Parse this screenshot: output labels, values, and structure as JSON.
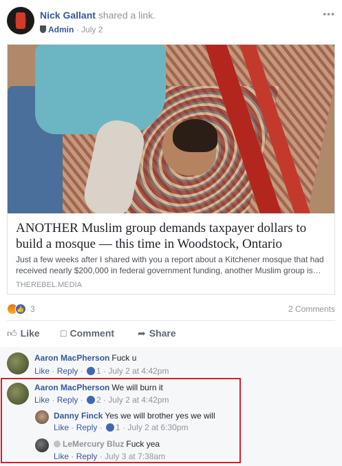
{
  "post": {
    "author": "Nick Gallant",
    "action": "shared a link.",
    "role": "Admin",
    "date": "July 2",
    "more": "•••"
  },
  "link": {
    "title": "ANOTHER Muslim group demands taxpayer dollars to build a mosque — this time in Woodstock, Ontario",
    "description": "Just a few weeks after I shared with you a report about a Kitchener mosque that had received nearly $200,000 in federal government funding, another Muslim group is…",
    "domain": "THEREBEL.MEDIA"
  },
  "stats": {
    "reaction_count": "3",
    "comments": "2 Comments"
  },
  "actions": {
    "like": "Like",
    "comment": "Comment",
    "share": "Share"
  },
  "comments": [
    {
      "name": "Aaron MacPherson",
      "text": "Fuck u",
      "like": "Like",
      "reply": "Reply",
      "likes": "1",
      "time": "July 2 at 4:42pm"
    },
    {
      "name": "Aaron MacPherson",
      "text": "We will burn it",
      "like": "Like",
      "reply": "Reply",
      "likes": "2",
      "time": "July 2 at 4:42pm",
      "replies": [
        {
          "name": "Danny Finck",
          "text": "Yes we will brother yes we will",
          "like": "Like",
          "reply": "Reply",
          "likes": "1",
          "time": "July 2 at 6:30pm"
        },
        {
          "name": "LeMercury Bluz",
          "text": "Fuck yea",
          "like": "Like",
          "reply": "Reply",
          "time": "July 3 at 7:38am"
        }
      ]
    }
  ],
  "colors": {
    "link_blue": "#365899",
    "highlight_red": "#d32027"
  }
}
